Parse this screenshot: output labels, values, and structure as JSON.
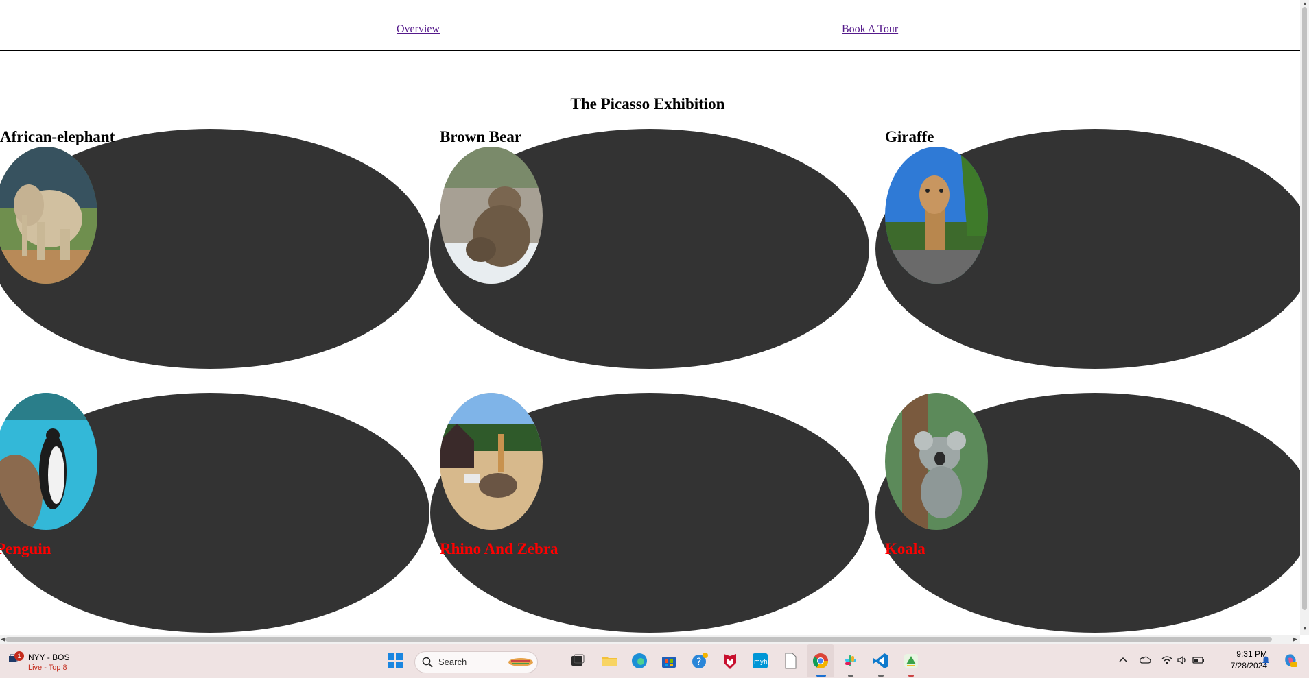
{
  "nav": {
    "overview": "Overview",
    "book_tour": "Book A Tour"
  },
  "page": {
    "title": "The Picasso Exhibition"
  },
  "exhibits": [
    {
      "name": "African-elephant"
    },
    {
      "name": "Brown Bear"
    },
    {
      "name": "Giraffe"
    },
    {
      "name": "Penguin"
    },
    {
      "name": "Rhino And Zebra"
    },
    {
      "name": "Koala"
    }
  ],
  "taskbar": {
    "news_badge": "1",
    "news_title": "NYY - BOS",
    "news_sub": "Live - Top 8",
    "search_placeholder": "Search",
    "time": "9:31 PM",
    "date": "7/28/2024"
  },
  "colors": {
    "blob": "#333333",
    "top_label": "#000000",
    "bottom_label": "#ff0000",
    "link": "#551a8b"
  }
}
